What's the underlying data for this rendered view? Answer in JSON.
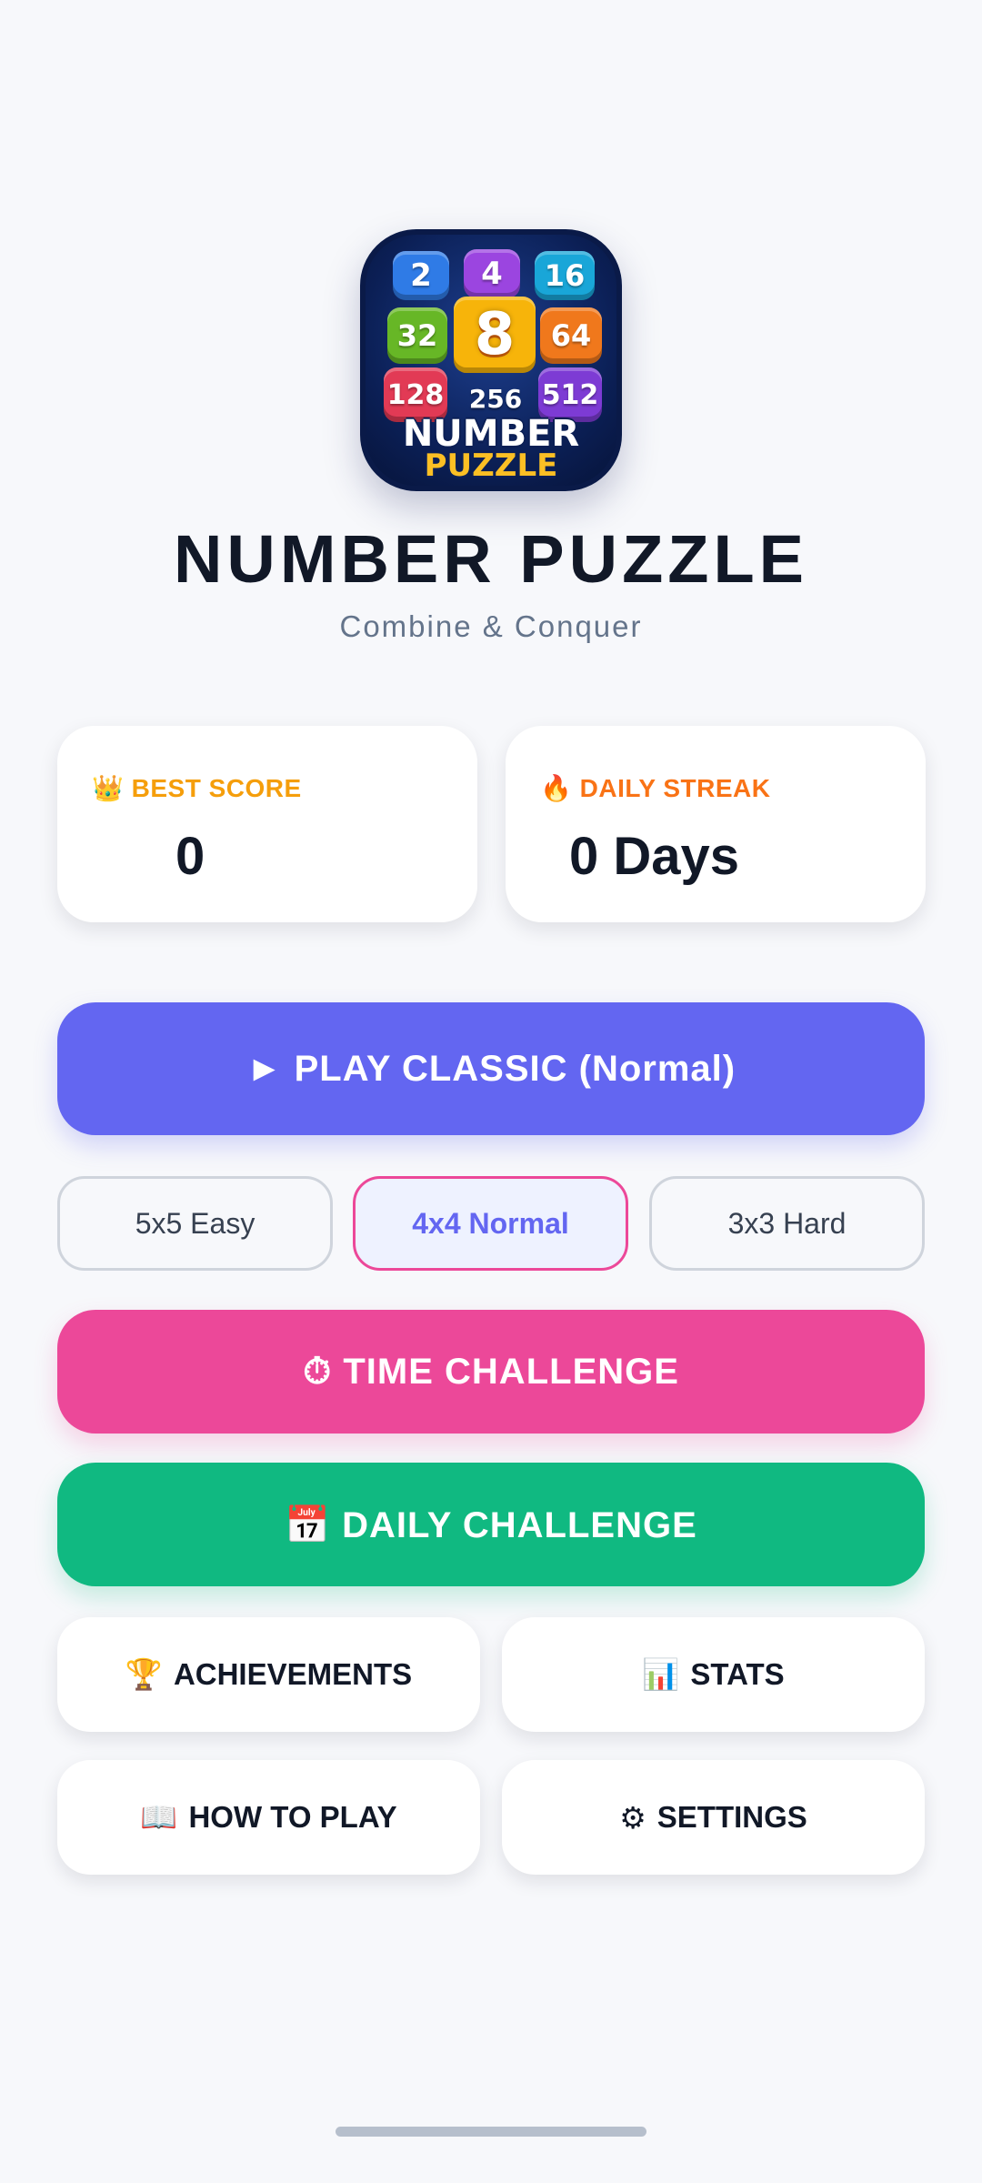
{
  "app": {
    "logo_tiles": [
      "2",
      "4",
      "16",
      "32",
      "8",
      "64",
      "128",
      "256",
      "512"
    ],
    "logo_text_line1": "NUMBER",
    "logo_text_line2": "PUZZLE",
    "title": "NUMBER PUZZLE",
    "subtitle": "Combine & Conquer"
  },
  "stats": {
    "best_score": {
      "icon": "👑",
      "label": "BEST SCORE",
      "value": "0"
    },
    "daily_streak": {
      "icon": "🔥",
      "label": "DAILY STREAK",
      "value": "0 Days"
    }
  },
  "actions": {
    "play_classic": "► PLAY CLASSIC (Normal)",
    "modes": [
      {
        "label": "5x5 Easy",
        "selected": false
      },
      {
        "label": "4x4 Normal",
        "selected": true
      },
      {
        "label": "3x3 Hard",
        "selected": false
      }
    ],
    "time_challenge": "⏱ TIME CHALLENGE",
    "daily_challenge": "📅 DAILY CHALLENGE",
    "achievements": {
      "icon": "🏆",
      "label": "ACHIEVEMENTS"
    },
    "stats": {
      "icon": "📊",
      "label": "STATS"
    },
    "how_to_play": {
      "icon": "📖",
      "label": "HOW TO PLAY"
    },
    "settings": {
      "icon": "⚙",
      "label": "SETTINGS"
    }
  },
  "colors": {
    "primary": "#6366f1",
    "pink": "#ec4899",
    "green": "#10b981",
    "gold": "#f59e0b",
    "orange": "#f97316"
  }
}
